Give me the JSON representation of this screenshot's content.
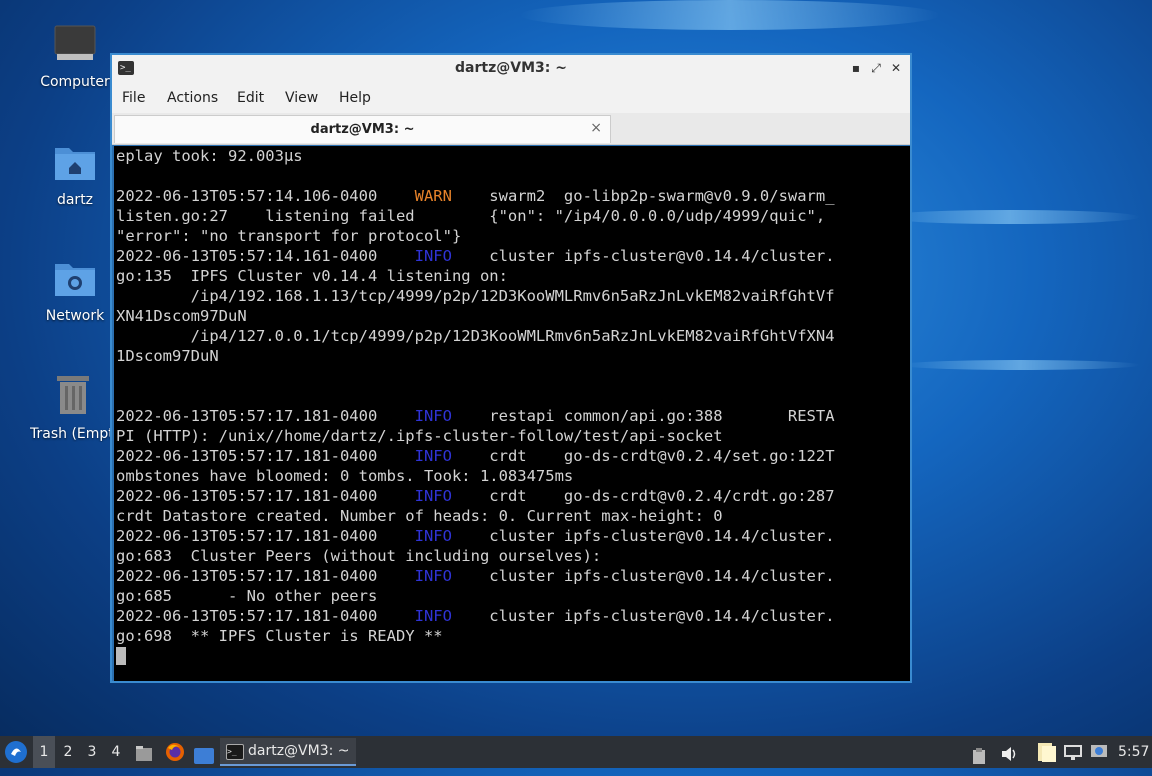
{
  "desktop": {
    "icons": [
      {
        "label": "Computer"
      },
      {
        "label": "dartz"
      },
      {
        "label": "Network"
      },
      {
        "label": "Trash (Empty)"
      }
    ]
  },
  "window": {
    "title": "dartz@VM3: ~",
    "menu": [
      "File",
      "Actions",
      "Edit",
      "View",
      "Help"
    ],
    "tab_label": "dartz@VM3: ~",
    "tab_close": "×",
    "controls": {
      "minimize": "▪",
      "maximize": "⤢",
      "close": "✕"
    }
  },
  "terminal": {
    "lines": [
      {
        "segments": [
          {
            "t": "eplay took: 92.003μs"
          }
        ]
      },
      {
        "segments": [
          {
            "t": ""
          }
        ]
      },
      {
        "segments": [
          {
            "t": "2022-06-13T05:57:14.106-0400    "
          },
          {
            "t": "WARN",
            "c": "warn"
          },
          {
            "t": "    swarm2  go-libp2p-swarm@v0.9.0/swarm_"
          }
        ]
      },
      {
        "segments": [
          {
            "t": "listen.go:27    listening failed        {\"on\": \"/ip4/0.0.0.0/udp/4999/quic\","
          }
        ]
      },
      {
        "segments": [
          {
            "t": "\"error\": \"no transport for protocol\"}"
          }
        ]
      },
      {
        "segments": [
          {
            "t": "2022-06-13T05:57:14.161-0400    "
          },
          {
            "t": "INFO",
            "c": "info"
          },
          {
            "t": "    cluster ipfs-cluster@v0.14.4/cluster."
          }
        ]
      },
      {
        "segments": [
          {
            "t": "go:135  IPFS Cluster v0.14.4 listening on:"
          }
        ]
      },
      {
        "segments": [
          {
            "t": "        /ip4/192.168.1.13/tcp/4999/p2p/12D3KooWMLRmv6n5aRzJnLvkEM82vaiRfGhtVf"
          }
        ]
      },
      {
        "segments": [
          {
            "t": "XN41Dscom97DuN"
          }
        ]
      },
      {
        "segments": [
          {
            "t": "        /ip4/127.0.0.1/tcp/4999/p2p/12D3KooWMLRmv6n5aRzJnLvkEM82vaiRfGhtVfXN4"
          }
        ]
      },
      {
        "segments": [
          {
            "t": "1Dscom97DuN"
          }
        ]
      },
      {
        "segments": [
          {
            "t": ""
          }
        ]
      },
      {
        "segments": [
          {
            "t": ""
          }
        ]
      },
      {
        "segments": [
          {
            "t": "2022-06-13T05:57:17.181-0400    "
          },
          {
            "t": "INFO",
            "c": "info"
          },
          {
            "t": "    restapi common/api.go:388       RESTA"
          }
        ]
      },
      {
        "segments": [
          {
            "t": "PI (HTTP): /unix//home/dartz/.ipfs-cluster-follow/test/api-socket"
          }
        ]
      },
      {
        "segments": [
          {
            "t": "2022-06-13T05:57:17.181-0400    "
          },
          {
            "t": "INFO",
            "c": "info"
          },
          {
            "t": "    crdt    go-ds-crdt@v0.2.4/set.go:122T"
          }
        ]
      },
      {
        "segments": [
          {
            "t": "ombstones have bloomed: 0 tombs. Took: 1.083475ms"
          }
        ]
      },
      {
        "segments": [
          {
            "t": "2022-06-13T05:57:17.181-0400    "
          },
          {
            "t": "INFO",
            "c": "info"
          },
          {
            "t": "    crdt    go-ds-crdt@v0.2.4/crdt.go:287"
          }
        ]
      },
      {
        "segments": [
          {
            "t": "crdt Datastore created. Number of heads: 0. Current max-height: 0"
          }
        ]
      },
      {
        "segments": [
          {
            "t": "2022-06-13T05:57:17.181-0400    "
          },
          {
            "t": "INFO",
            "c": "info"
          },
          {
            "t": "    cluster ipfs-cluster@v0.14.4/cluster."
          }
        ]
      },
      {
        "segments": [
          {
            "t": "go:683  Cluster Peers (without including ourselves):"
          }
        ]
      },
      {
        "segments": [
          {
            "t": "2022-06-13T05:57:17.181-0400    "
          },
          {
            "t": "INFO",
            "c": "info"
          },
          {
            "t": "    cluster ipfs-cluster@v0.14.4/cluster."
          }
        ]
      },
      {
        "segments": [
          {
            "t": "go:685      - No other peers"
          }
        ]
      },
      {
        "segments": [
          {
            "t": "2022-06-13T05:57:17.181-0400    "
          },
          {
            "t": "INFO",
            "c": "info"
          },
          {
            "t": "    cluster ipfs-cluster@v0.14.4/cluster."
          }
        ]
      },
      {
        "segments": [
          {
            "t": "go:698  ** IPFS Cluster is READY **"
          }
        ]
      }
    ],
    "colors": {
      "warn": "#e8832a",
      "info": "#2f33d6",
      "text": "#d3d3d3"
    }
  },
  "taskbar": {
    "workspaces": [
      "1",
      "2",
      "3",
      "4"
    ],
    "task_label": "dartz@VM3: ~",
    "clock": "5:57"
  }
}
